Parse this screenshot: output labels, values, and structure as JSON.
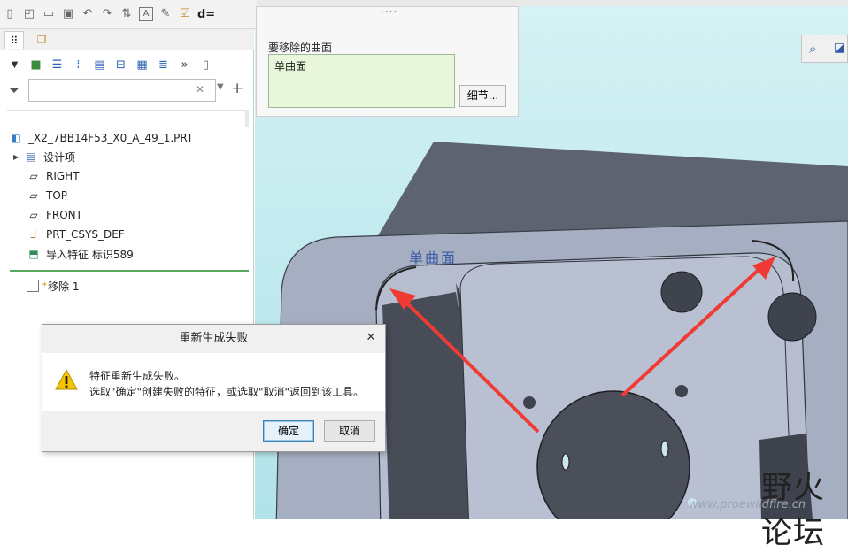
{
  "toolbar": {
    "partial_label": "d="
  },
  "model_tree": {
    "filter_placeholder": "",
    "root": "_X2_7BB14F53_X0_A_49_1.PRT",
    "items": [
      {
        "label": "设计项",
        "icon": "design-items-icon"
      },
      {
        "label": "RIGHT",
        "icon": "datum-plane-icon"
      },
      {
        "label": "TOP",
        "icon": "datum-plane-icon"
      },
      {
        "label": "FRONT",
        "icon": "datum-plane-icon"
      },
      {
        "label": "PRT_CSYS_DEF",
        "icon": "csys-icon"
      },
      {
        "label": "导入特征 标识589",
        "icon": "import-feature-icon"
      }
    ],
    "new_feature": {
      "marker": "*",
      "label": "移除 1"
    }
  },
  "collector": {
    "title": "要移除的曲面",
    "value": "单曲面",
    "details_button": "细节..."
  },
  "model_annotation": "单曲面",
  "dialog": {
    "title": "重新生成失败",
    "line1": "特征重新生成失败。",
    "line2": "选取\"确定\"创建失败的特征，或选取\"取消\"返回到该工具。",
    "ok": "确定",
    "cancel": "取消"
  },
  "watermark": {
    "text": "野火论坛",
    "url": "www.proewildfire.cn"
  },
  "colors": {
    "collector_bg": "#e8f7d9",
    "insert_line": "#55a85a",
    "arrow": "#ef3b33",
    "warning": "#f5c400"
  }
}
